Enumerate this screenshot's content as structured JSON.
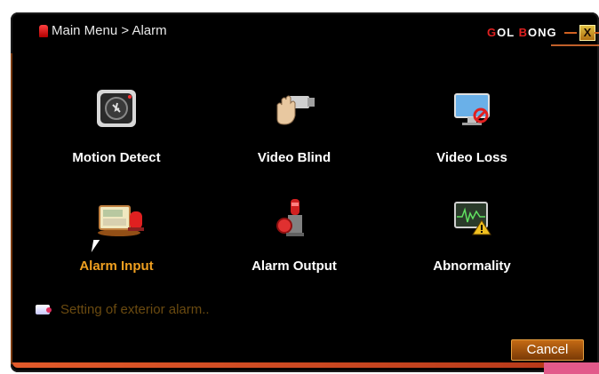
{
  "window": {
    "breadcrumb": "Main Menu > Alarm",
    "brand": {
      "part1": "G",
      "part2": "OL",
      "part3": "B",
      "part4": "ONG"
    },
    "close_label": "X"
  },
  "menu": {
    "items": [
      {
        "label": "Motion Detect",
        "icon": "motion-detect-icon"
      },
      {
        "label": "Video Blind",
        "icon": "video-blind-icon"
      },
      {
        "label": "Video Loss",
        "icon": "video-loss-icon"
      },
      {
        "label": "Alarm Input",
        "icon": "alarm-input-icon",
        "active": true
      },
      {
        "label": "Alarm Output",
        "icon": "alarm-output-icon"
      },
      {
        "label": "Abnormality",
        "icon": "abnormality-icon"
      }
    ]
  },
  "status": {
    "text": "Setting of exterior alarm.."
  },
  "actions": {
    "cancel_label": "Cancel"
  },
  "colors": {
    "background": "#000000",
    "accent": "#f0a020",
    "label": "#ffffff",
    "status_text": "#6a4a10",
    "button": "#c46a14"
  }
}
